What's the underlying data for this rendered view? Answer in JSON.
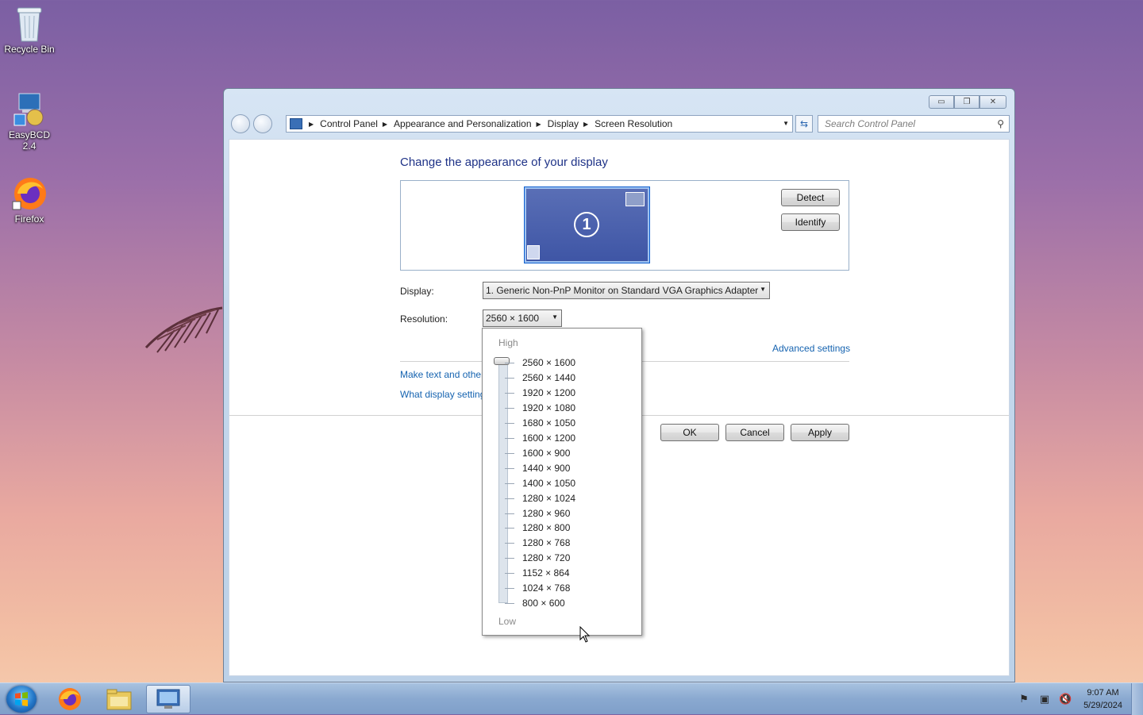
{
  "desktop": {
    "icons": [
      {
        "label": "Recycle Bin",
        "icon": "recycle-bin-icon"
      },
      {
        "label": "EasyBCD 2.4",
        "icon": "easybcd-icon"
      },
      {
        "label": "Firefox",
        "icon": "firefox-icon"
      }
    ]
  },
  "window": {
    "breadcrumb": [
      "Control Panel",
      "Appearance and Personalization",
      "Display",
      "Screen Resolution"
    ],
    "search_placeholder": "Search Control Panel",
    "title": "Change the appearance of your display",
    "monitor_number": "1",
    "detect_label": "Detect",
    "identify_label": "Identify",
    "display_label": "Display:",
    "display_value": "1. Generic Non-PnP Monitor on Standard VGA Graphics Adapter",
    "resolution_label": "Resolution:",
    "resolution_value": "2560 × 1600",
    "advanced_link": "Advanced settings",
    "link_text_size": "Make text and other",
    "link_display_settings": "What display setting",
    "ok_label": "OK",
    "cancel_label": "Cancel",
    "apply_label": "Apply"
  },
  "resolution_popup": {
    "high_label": "High",
    "low_label": "Low",
    "options": [
      "2560 × 1600",
      "2560 × 1440",
      "1920 × 1200",
      "1920 × 1080",
      "1680 × 1050",
      "1600 × 1200",
      "1600 × 900",
      "1440 × 900",
      "1400 × 1050",
      "1280 × 1024",
      "1280 × 960",
      "1280 × 800",
      "1280 × 768",
      "1280 × 720",
      "1152 × 864",
      "1024 × 768",
      "800 × 600"
    ],
    "selected": "2560 × 1600"
  },
  "taskbar": {
    "apps": [
      "start-orb",
      "firefox-icon",
      "file-explorer-icon",
      "control-panel-icon"
    ],
    "time": "9:07 AM",
    "date": "5/29/2024"
  }
}
